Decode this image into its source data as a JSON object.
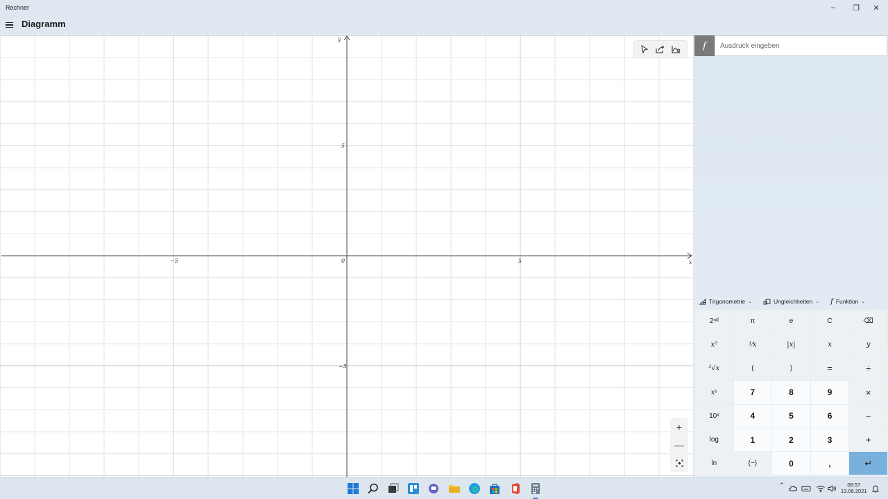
{
  "window": {
    "title": "Rechner"
  },
  "header": {
    "title": "Diagramm"
  },
  "graph": {
    "x_axis_label": "x",
    "y_axis_label": "y",
    "x_ticks": [
      "−5",
      "0",
      "5"
    ],
    "y_ticks": [
      "5",
      "−5"
    ],
    "x_range": [
      -10,
      10
    ],
    "y_range": [
      -10,
      10
    ],
    "grid": true
  },
  "expression": {
    "fx_label": "f",
    "placeholder": "Ausdruck eingeben"
  },
  "categories": [
    {
      "label": "Trigonometrie",
      "icon": "triangle-icon"
    },
    {
      "label": "Ungleichheiten",
      "icon": "inequality-icon"
    },
    {
      "label": "Funktion",
      "icon": "function-icon"
    }
  ],
  "keypad": [
    [
      "2ⁿᵈ",
      "π",
      "e",
      "C",
      "⌫"
    ],
    [
      "x²",
      "¹⁄x",
      "|x|",
      "x",
      "y"
    ],
    [
      "²√x",
      "(",
      ")",
      "=",
      "÷"
    ],
    [
      "xʸ",
      "7",
      "8",
      "9",
      "×"
    ],
    [
      "10ˣ",
      "4",
      "5",
      "6",
      "−"
    ],
    [
      "log",
      "1",
      "2",
      "3",
      "+"
    ],
    [
      "ln",
      "(−)",
      "0",
      ",",
      "↵"
    ]
  ],
  "clock": {
    "time": "08:57",
    "date": "13.08.2021"
  },
  "colors": {
    "accent": "#79b1de",
    "axis": "#444444",
    "grid": "#e3e3e3"
  }
}
